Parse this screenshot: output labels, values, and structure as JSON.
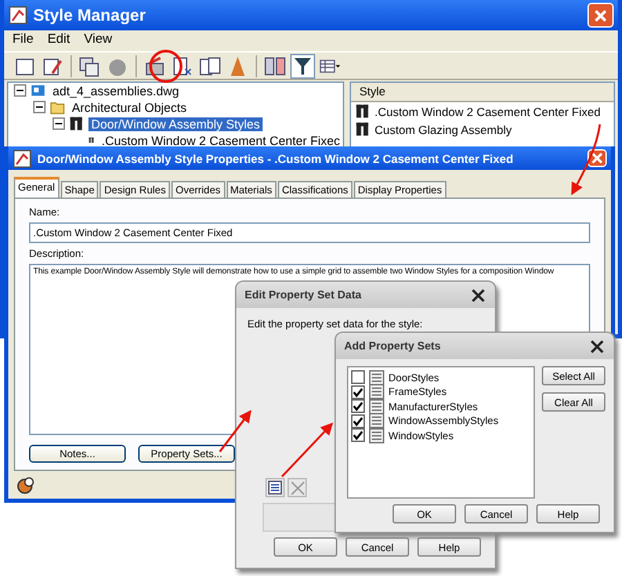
{
  "style_manager": {
    "title": "Style Manager",
    "menu": [
      "File",
      "Edit",
      "View"
    ],
    "tree": [
      {
        "label": "adt_4_assemblies.dwg",
        "kind": "drawing",
        "expanded": true,
        "selected": false,
        "children": [
          {
            "label": "Architectural Objects",
            "kind": "folder",
            "expanded": true,
            "selected": false,
            "children": [
              {
                "label": "Door/Window Assembly Styles",
                "kind": "style-group",
                "expanded": true,
                "selected": true,
                "children": [
                  {
                    "label": ".Custom Window 2 Casement Center Fixec",
                    "kind": "style",
                    "selected": false
                  }
                ]
              }
            ]
          }
        ]
      }
    ],
    "style_list": {
      "header": "Style",
      "rows": [
        ".Custom Window 2 Casement Center Fixed",
        "Custom Glazing Assembly"
      ]
    }
  },
  "properties_dialog": {
    "title": "Door/Window Assembly Style Properties - .Custom Window 2 Casement Center Fixed",
    "tabs": [
      {
        "label": "General",
        "selected": true
      },
      {
        "label": "Shape",
        "selected": false
      },
      {
        "label": "Design Rules",
        "selected": false
      },
      {
        "label": "Overrides",
        "selected": false
      },
      {
        "label": "Materials",
        "selected": false
      },
      {
        "label": "Classifications",
        "selected": false
      },
      {
        "label": "Display Properties",
        "selected": false
      }
    ],
    "name_label": "Name:",
    "name_value": ".Custom Window 2 Casement Center Fixed",
    "description_label": "Description:",
    "description_value": "This example Door/Window Assembly Style will demonstrate how to use a simple grid to assemble two Window Styles for a composition Window",
    "buttons": [
      "Notes...",
      "Property Sets..."
    ]
  },
  "edit_property_set_dialog": {
    "title": "Edit Property Set Data",
    "prompt": "Edit the property set data for the style:",
    "buttons": [
      "OK",
      "Cancel",
      "Help"
    ]
  },
  "add_property_sets_dialog": {
    "title": "Add Property Sets",
    "items": [
      {
        "label": "DoorStyles",
        "checked": false
      },
      {
        "label": "FrameStyles",
        "checked": true
      },
      {
        "label": "ManufacturerStyles",
        "checked": true
      },
      {
        "label": "WindowAssemblyStyles",
        "checked": true
      },
      {
        "label": "WindowStyles",
        "checked": true
      }
    ],
    "side_buttons": [
      "Select All",
      "Clear All"
    ],
    "buttons": [
      "OK",
      "Cancel",
      "Help"
    ]
  }
}
